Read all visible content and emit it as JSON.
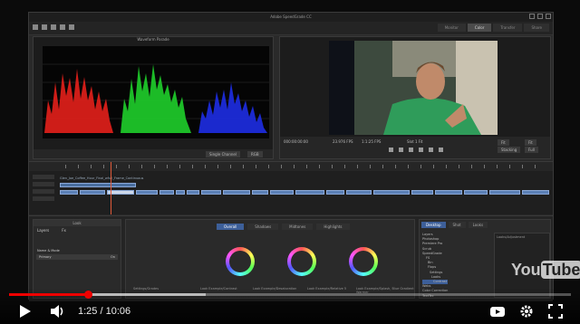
{
  "app": {
    "title": "Adobe SpeedGrade CC",
    "mode_tabs": [
      "Monitor",
      "Color",
      "Transfer",
      "Share"
    ],
    "active_mode_index": 1
  },
  "scope": {
    "header": "Waveform Parade",
    "dropdown1": "Single Channel",
    "dropdown2": "RGB"
  },
  "viewer": {
    "timecode_left": "000:00:00:00",
    "fps": "23.976 FPS",
    "timecode_mid": "1:1:25 FPS",
    "frame": "Slot 1 Fit",
    "btn_pip": "Stacking",
    "btn_full": "Full",
    "btn_a": "Fit",
    "btn_b": "Fit"
  },
  "timeline": {
    "sequence_label": "Glen_Joe_Coffee_Hour_Final_wfull_Frame_Continuous"
  },
  "layers_panel": {
    "header": "Look",
    "tab_label": "Layers",
    "fx_label": "Fx",
    "row_label": "Name & Mode",
    "primary_label": "Primary",
    "checkbox_label": "On"
  },
  "color_panel": {
    "tabs": [
      "Overall",
      "Shadows",
      "Midtones",
      "Highlights"
    ],
    "active_tab_index": 0,
    "fields": [
      "Look Example/Contrast",
      "Look Example/Desaturation",
      "Look Example/Relative 5",
      "Look Example/Splash, Blue Gradient Warmer"
    ],
    "left_field": "Settings/Grades"
  },
  "file_panel": {
    "tabs": [
      "Desktop",
      "Shot",
      "Looks"
    ],
    "active_tab_index": 0,
    "sidebox_label": "Looks/Adjustment",
    "tree": [
      "Layers",
      "Photoshop",
      "Premiere Pro",
      "Scrub",
      "SpeedGrade",
      "FS",
      "Bin",
      "Flops",
      "Settings",
      "Looks",
      "Contrast",
      "Webs",
      "Color Correction",
      "TextTec"
    ],
    "selected_tree_index": 10
  },
  "player": {
    "time_text": "1:25 / 10:06",
    "progress_fraction": 0.14,
    "buffer_fraction": 0.35,
    "logo_you": "You",
    "logo_tube": "Tube"
  },
  "colors": {
    "progress": "#ee0000",
    "accent": "#3d5f99"
  }
}
